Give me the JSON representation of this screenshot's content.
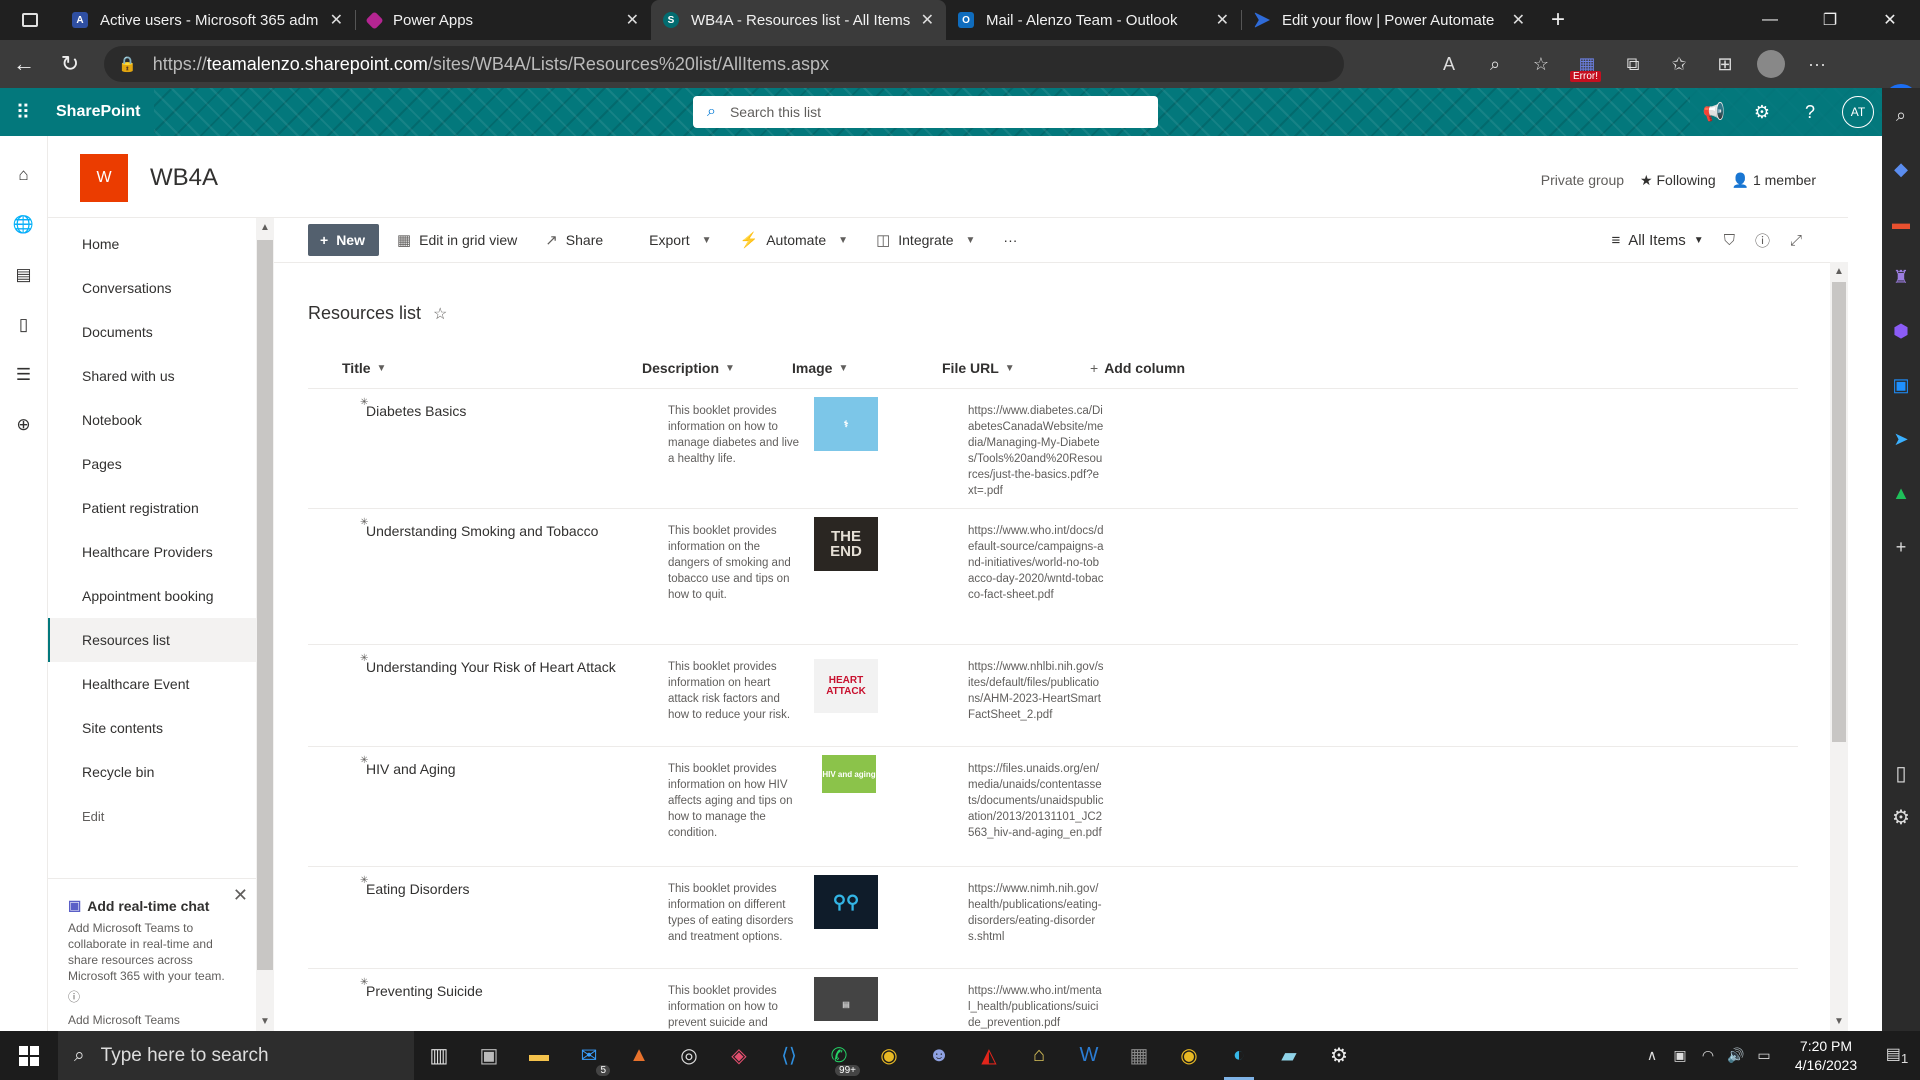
{
  "browser": {
    "tabs": [
      {
        "label": "Active users - Microsoft 365 adm",
        "icon": "m365-admin-icon",
        "color": "#2f4fa2"
      },
      {
        "label": "Power Apps",
        "icon": "power-apps-icon",
        "color": "#b42591"
      },
      {
        "label": "WB4A - Resources list - All Items",
        "icon": "sharepoint-icon",
        "color": "#036c70"
      },
      {
        "label": "Mail - Alenzo Team - Outlook",
        "icon": "outlook-icon",
        "color": "#0f6cbd"
      },
      {
        "label": "Edit your flow | Power Automate",
        "icon": "power-automate-icon",
        "color": "#2f6bd8"
      }
    ],
    "url_prefix": "https://",
    "url_host": "teamalenzo.sharepoint.com",
    "url_path": "/sites/WB4A/Lists/Resources%20list/AllItems.aspx",
    "error_badge": "Error!"
  },
  "suite": {
    "brand": "SharePoint",
    "search_placeholder": "Search this list",
    "user_initials": "AT",
    "accent": "#03787c"
  },
  "site": {
    "logo_letter": "W",
    "logo_color": "#eb3c00",
    "title": "WB4A",
    "privacy": "Private group",
    "following": "Following",
    "members": "1 member"
  },
  "nav": {
    "items": [
      {
        "label": "Home"
      },
      {
        "label": "Conversations"
      },
      {
        "label": "Documents"
      },
      {
        "label": "Shared with us"
      },
      {
        "label": "Notebook"
      },
      {
        "label": "Pages"
      },
      {
        "label": "Patient registration"
      },
      {
        "label": "Healthcare Providers"
      },
      {
        "label": "Appointment booking"
      },
      {
        "label": "Resources list"
      },
      {
        "label": "Healthcare Event"
      },
      {
        "label": "Site contents"
      },
      {
        "label": "Recycle bin"
      }
    ],
    "selected_index": 9,
    "edit_label": "Edit"
  },
  "teams_card": {
    "title": "Add real-time chat",
    "text": "Add Microsoft Teams to collaborate in real-time and share resources across Microsoft 365 with your team.",
    "link": "Add Microsoft Teams"
  },
  "commands": {
    "new": "New",
    "edit_grid": "Edit in grid view",
    "share": "Share",
    "export": "Export",
    "automate": "Automate",
    "integrate": "Integrate",
    "more": "···",
    "view": "All Items"
  },
  "list": {
    "title": "Resources list",
    "columns": {
      "title": "Title",
      "description": "Description",
      "image": "Image",
      "file_url": "File URL",
      "add": "Add column"
    },
    "rows": [
      {
        "title": "Diabetes Basics",
        "description": "This booklet provides information on how to manage diabetes and live a healthy life.",
        "image_text": "",
        "image_bg": "#7cc6e8",
        "url": "https://www.diabetes.ca/DiabetesCanadaWebsite/media/Managing-My-Diabetes/Tools%20and%20Resources/just-the-basics.pdf?ext=.pdf"
      },
      {
        "title": "Understanding Smoking and Tobacco",
        "description": "This booklet provides information on the dangers of smoking and tobacco use and tips on how to quit.",
        "image_text": "THE END",
        "image_bg": "#2a2622",
        "url": "https://www.who.int/docs/default-source/campaigns-and-initiatives/world-no-tobacco-day-2020/wntd-tobacco-fact-sheet.pdf"
      },
      {
        "title": "Understanding Your Risk of Heart Attack",
        "description": "This booklet provides information on heart attack risk factors and how to reduce your risk.",
        "image_text": "HEART ATTACK",
        "image_bg": "#f2f2f2",
        "url": "https://www.nhlbi.nih.gov/sites/default/files/publications/AHM-2023-HeartSmartFactSheet_2.pdf"
      },
      {
        "title": "HIV and Aging",
        "description": "This booklet provides information on how HIV affects aging and tips on how to manage the condition.",
        "image_text": "HIV and aging",
        "image_bg": "#8bc34a",
        "url": "https://files.unaids.org/en/media/unaids/contentassets/documents/unaidspublication/2013/20131101_JC2563_hiv-and-aging_en.pdf"
      },
      {
        "title": "Eating Disorders",
        "description": "This booklet provides information on different types of eating disorders and treatment options.",
        "image_text": "",
        "image_bg": "#0f1c2a",
        "url": "https://www.nimh.nih.gov/health/publications/eating-disorders/eating-disorders.shtml"
      },
      {
        "title": "Preventing Suicide",
        "description": "This booklet provides information on how to prevent suicide and",
        "image_text": "",
        "image_bg": "#444444",
        "url": "https://www.who.int/mental_health/publications/suicide_prevention.pdf"
      }
    ]
  },
  "taskbar": {
    "search_placeholder": "Type here to search",
    "mail_badge": "5",
    "whatsapp_badge": "99+",
    "time": "7:20 PM",
    "date": "4/16/2023",
    "notifications": "1"
  }
}
